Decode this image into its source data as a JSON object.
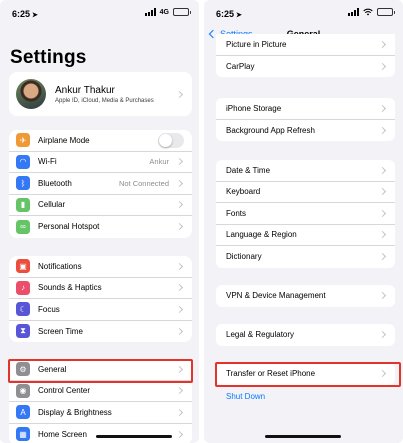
{
  "left": {
    "status": {
      "time": "6:25",
      "network": "4G"
    },
    "title": "Settings",
    "profile": {
      "name": "Ankur Thakur",
      "subtitle": "Apple ID, iCloud, Media & Purchases"
    },
    "group1": [
      {
        "label": "Airplane Mode",
        "icon": "airplane-icon",
        "color": "#f09a37",
        "toggle": true
      },
      {
        "label": "Wi-Fi",
        "icon": "wifi-icon",
        "color": "#3478f6",
        "value": "Ankur"
      },
      {
        "label": "Bluetooth",
        "icon": "bluetooth-icon",
        "color": "#3478f6",
        "value": "Not Connected"
      },
      {
        "label": "Cellular",
        "icon": "cellular-icon",
        "color": "#65c466"
      },
      {
        "label": "Personal Hotspot",
        "icon": "hotspot-icon",
        "color": "#65c466"
      }
    ],
    "group2": [
      {
        "label": "Notifications",
        "icon": "notifications-icon",
        "color": "#eb4e3d"
      },
      {
        "label": "Sounds & Haptics",
        "icon": "sound-icon",
        "color": "#eb4e6b"
      },
      {
        "label": "Focus",
        "icon": "moon-icon",
        "color": "#5856d6"
      },
      {
        "label": "Screen Time",
        "icon": "hourglass-icon",
        "color": "#5856d6"
      }
    ],
    "group3": [
      {
        "label": "General",
        "icon": "gear-icon",
        "color": "#8e8e93"
      },
      {
        "label": "Control Center",
        "icon": "control-center-icon",
        "color": "#8e8e93"
      },
      {
        "label": "Display & Brightness",
        "icon": "display-icon",
        "color": "#3478f6"
      },
      {
        "label": "Home Screen",
        "icon": "home-screen-icon",
        "color": "#3478f6"
      }
    ]
  },
  "right": {
    "status": {
      "time": "6:25"
    },
    "nav": {
      "back": "Settings",
      "title": "General"
    },
    "group1": [
      "Picture in Picture",
      "CarPlay"
    ],
    "group2": [
      "iPhone Storage",
      "Background App Refresh"
    ],
    "group3": [
      "Date & Time",
      "Keyboard",
      "Fonts",
      "Language & Region",
      "Dictionary"
    ],
    "group4": [
      "VPN & Device Management"
    ],
    "group5": [
      "Legal & Regulatory"
    ],
    "group6": [
      "Transfer or Reset iPhone"
    ],
    "shutdown": "Shut Down"
  },
  "colors": {
    "highlight": "#e2342b",
    "link": "#0a7aff",
    "background": "#f2f2f7"
  }
}
